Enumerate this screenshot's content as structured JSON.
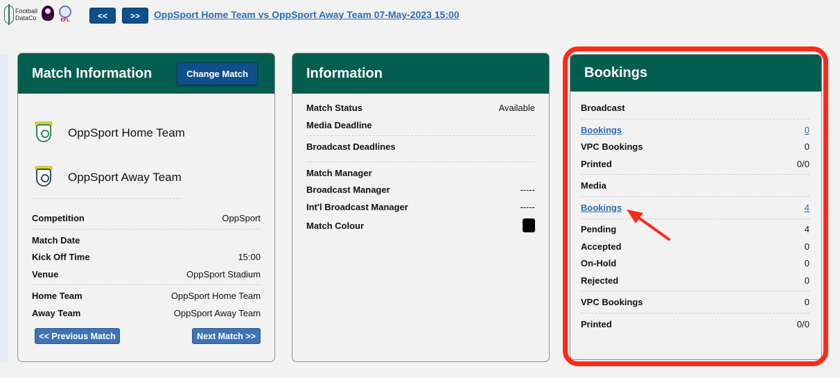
{
  "header": {
    "logo_text": "Football DataCo",
    "efl_text": "EFL",
    "prev_label": "<<",
    "next_label": ">>",
    "match_link": "OppSport Home Team vs OppSport Away Team 07-May-2023 15:00"
  },
  "match_info": {
    "title": "Match Information",
    "change_button": "Change Match",
    "home_team": "OppSport Home Team",
    "away_team": "OppSport Away Team",
    "rows": {
      "competition": {
        "label": "Competition",
        "value": "OppSport"
      },
      "match_date": {
        "label": "Match Date",
        "value": ""
      },
      "kickoff": {
        "label": "Kick Off Time",
        "value": "15:00"
      },
      "venue": {
        "label": "Venue",
        "value": "OppSport Stadium"
      },
      "home": {
        "label": "Home Team",
        "value": "OppSport Home Team"
      },
      "away": {
        "label": "Away Team",
        "value": "OppSport Away Team"
      }
    },
    "prev_match": "<< Previous Match",
    "next_match": "Next Match >>"
  },
  "information": {
    "title": "Information",
    "rows": {
      "status": {
        "label": "Match Status",
        "value": "Available"
      },
      "media_deadline": {
        "label": "Media Deadline",
        "value": ""
      },
      "broadcast_deadlines": {
        "label": "Broadcast Deadlines",
        "value": ""
      },
      "match_manager": {
        "label": "Match Manager",
        "value": ""
      },
      "broadcast_manager": {
        "label": "Broadcast Manager",
        "value": "-----"
      },
      "intl_broadcast_manager": {
        "label": "Int'l Broadcast Manager",
        "value": "-----"
      },
      "match_colour": {
        "label": "Match Colour",
        "value": ""
      }
    },
    "match_colour_hex": "#000000"
  },
  "bookings": {
    "title": "Bookings",
    "broadcast": {
      "heading": "Broadcast",
      "bookings_label": "Bookings",
      "bookings_value": "0",
      "vpc_label": "VPC Bookings",
      "vpc_value": "0",
      "printed_label": "Printed",
      "printed_value": "0/0"
    },
    "media": {
      "heading": "Media",
      "bookings_label": "Bookings",
      "bookings_value": "4",
      "pending_label": "Pending",
      "pending_value": "4",
      "accepted_label": "Accepted",
      "accepted_value": "0",
      "onhold_label": "On-Hold",
      "onhold_value": "0",
      "rejected_label": "Rejected",
      "rejected_value": "0",
      "vpc_label": "VPC Bookings",
      "vpc_value": "0",
      "printed_label": "Printed",
      "printed_value": "0/0"
    }
  },
  "colors": {
    "panel_header": "#035e50",
    "button_blue": "#0f4f8a",
    "link_blue": "#2f6cb3",
    "highlight_red": "#ff2a1a"
  }
}
